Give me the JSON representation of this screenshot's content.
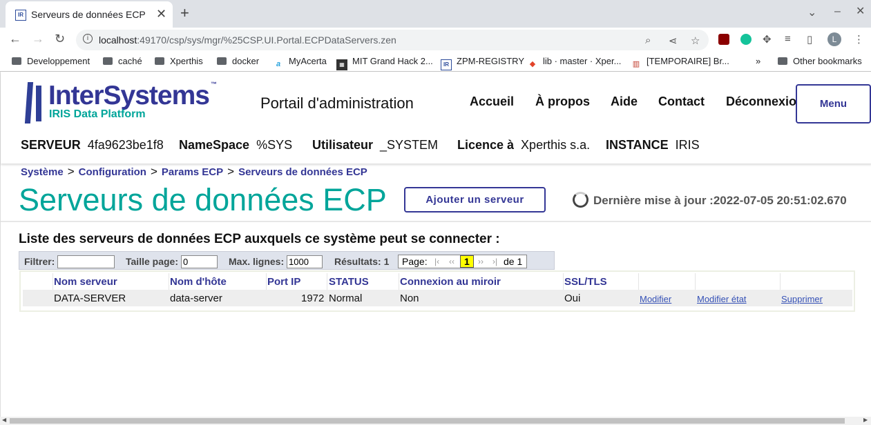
{
  "browser": {
    "tab_title": "Serveurs de données ECP",
    "tab_favicon_text": "IR",
    "url_host": "localhost",
    "url_rest": ":49170/csp/sys/mgr/%25CSP.UI.Portal.ECPDataServers.zen",
    "profile_initial": "L",
    "bookmarks": [
      "Developpement",
      "caché",
      "Xperthis",
      "docker",
      "MyAcerta",
      "MIT Grand Hack 2...",
      "ZPM-REGISTRY",
      "lib · master · Xper...",
      "[TEMPORAIRE] Br...",
      "Other bookmarks"
    ],
    "bookmarks_overflow": "»"
  },
  "header": {
    "logo_main": "InterSystems",
    "logo_tm": "™",
    "logo_sub": "IRIS Data Platform",
    "portal_title": "Portail d'administration",
    "nav": [
      "Accueil",
      "À propos",
      "Aide",
      "Contact",
      "Déconnexion"
    ],
    "menu_label": "Menu",
    "info": {
      "server_label": "SERVEUR",
      "server_value": "4fa9623be1f8",
      "namespace_label": "NameSpace",
      "namespace_value": "%SYS",
      "user_label": "Utilisateur",
      "user_value": "_SYSTEM",
      "licence_label": "Licence à",
      "licence_value": "Xperthis s.a.",
      "instance_label": "INSTANCE",
      "instance_value": "IRIS"
    }
  },
  "breadcrumb": [
    "Système",
    "Configuration",
    "Params ECP",
    "Serveurs de données ECP"
  ],
  "page_title": "Serveurs de données ECP",
  "add_server_label": "Ajouter un serveur",
  "last_update": "Dernière mise à jour :2022-07-05 20:51:02.670",
  "list_title": "Liste des serveurs de données ECP auxquels ce système peut se connecter :",
  "filterbar": {
    "filter_label": "Filtrer:",
    "filter_value": "",
    "page_size_label": "Taille page:",
    "page_size_value": "0",
    "max_rows_label": "Max. lignes:",
    "max_rows_value": "1000",
    "results_label": "Résultats: 1",
    "page_label": "Page:",
    "current_page": "1",
    "page_of": "de 1"
  },
  "table": {
    "headers": [
      "Nom serveur",
      "Nom d'hôte",
      "Port IP",
      "STATUS",
      "Connexion au miroir",
      "SSL/TLS"
    ],
    "rows": [
      {
        "name": "DATA-SERVER",
        "host": "data-server",
        "port": "1972",
        "status": "Normal",
        "mirror": "Non",
        "ssl": "Oui",
        "actions": [
          "Modifier",
          "Modifier état",
          "Supprimer"
        ]
      }
    ]
  },
  "colors": {
    "brand_blue": "#333695",
    "brand_teal": "#00a59a",
    "link": "#3551b6",
    "page_highlight": "#ffff00"
  }
}
